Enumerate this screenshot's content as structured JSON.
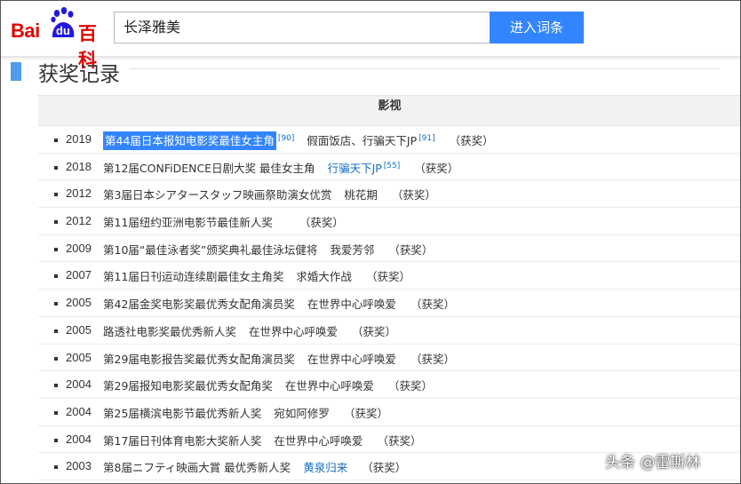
{
  "header": {
    "logo": {
      "bai": "Bai",
      "du": "du",
      "baike": "百科"
    },
    "search": {
      "value": "长泽雅美",
      "button": "进入词条"
    }
  },
  "section": {
    "title": "获奖记录",
    "table_header": "影视"
  },
  "awards": [
    {
      "year": "2019",
      "award": "第44届日本报知电影奖最佳女主角",
      "ref": "[90]",
      "work": "假面饭店、行骗天下JP",
      "work_ref": "[91]",
      "result": "（获奖）",
      "highlight": true,
      "work_link": false
    },
    {
      "year": "2018",
      "award": "第12届CONFiDENCE日剧大奖 最佳女主角",
      "ref": "",
      "work": "行骗天下JP",
      "work_ref": "[55]",
      "result": "（获奖）",
      "highlight": false,
      "work_link": true
    },
    {
      "year": "2012",
      "award": "第3届日本シアタースタッフ映画祭助演女优赏",
      "ref": "",
      "work": "桃花期",
      "work_ref": "",
      "result": "（获奖）",
      "highlight": false,
      "work_link": false
    },
    {
      "year": "2012",
      "award": "第11届纽约亚洲电影节最佳新人奖",
      "ref": "",
      "work": "",
      "work_ref": "",
      "result": "（获奖）",
      "highlight": false,
      "work_link": false
    },
    {
      "year": "2009",
      "award": "第10届“最佳泳者奖”颁奖典礼最佳泳坛健将",
      "ref": "",
      "work": "我爱芳邻",
      "work_ref": "",
      "result": "（获奖）",
      "highlight": false,
      "work_link": false
    },
    {
      "year": "2007",
      "award": "第11届日刊运动连续剧最佳女主角奖",
      "ref": "",
      "work": "求婚大作战",
      "work_ref": "",
      "result": "（获奖）",
      "highlight": false,
      "work_link": false
    },
    {
      "year": "2005",
      "award": "第42届金奖电影奖最优秀女配角演员奖",
      "ref": "",
      "work": "在世界中心呼唤爱",
      "work_ref": "",
      "result": "（获奖）",
      "highlight": false,
      "work_link": false
    },
    {
      "year": "2005",
      "award": "路透社电影奖最优秀新人奖",
      "ref": "",
      "work": "在世界中心呼唤爱",
      "work_ref": "",
      "result": "（获奖）",
      "highlight": false,
      "work_link": false
    },
    {
      "year": "2005",
      "award": "第29届电影报告奖最优秀女配角演员奖",
      "ref": "",
      "work": "在世界中心呼唤爱",
      "work_ref": "",
      "result": "（获奖）",
      "highlight": false,
      "work_link": false
    },
    {
      "year": "2004",
      "award": "第29届报知电影奖最优秀女配角奖",
      "ref": "",
      "work": "在世界中心呼唤爱",
      "work_ref": "",
      "result": "（获奖）",
      "highlight": false,
      "work_link": false
    },
    {
      "year": "2004",
      "award": "第25届横滨电影节最优秀新人奖",
      "ref": "",
      "work": "宛如阿修罗",
      "work_ref": "",
      "result": "（获奖）",
      "highlight": false,
      "work_link": false
    },
    {
      "year": "2004",
      "award": "第17届日刊体育电影大奖新人奖",
      "ref": "",
      "work": "在世界中心呼唤爱",
      "work_ref": "",
      "result": "（获奖）",
      "highlight": false,
      "work_link": false
    },
    {
      "year": "2003",
      "award": "第8届ニフティ映画大賞 最优秀新人奖",
      "ref": "",
      "work": "黄泉归来",
      "work_ref": "",
      "result": "（获奖）",
      "highlight": false,
      "work_link": true
    }
  ],
  "watermark": "头条 @雷斯林",
  "colors": {
    "brand_red": "#e10601",
    "accent_blue": "#3385ff",
    "link_blue": "#136ec2",
    "section_bar": "#4f9cee"
  }
}
